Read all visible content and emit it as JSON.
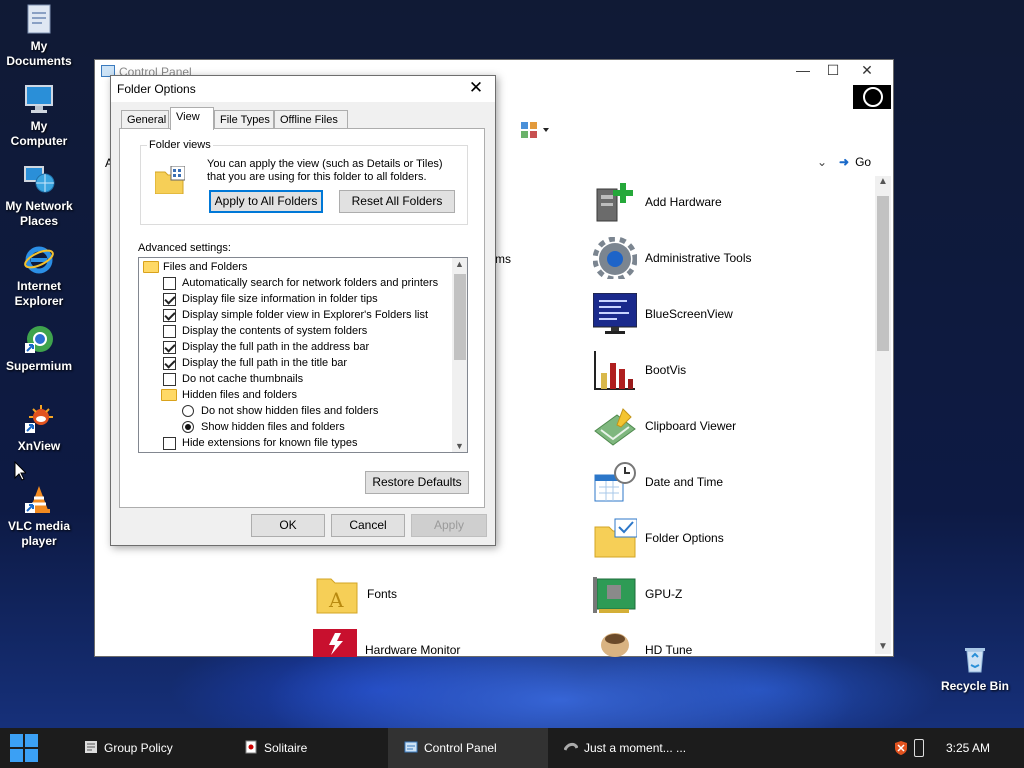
{
  "desktop": {
    "icons": [
      {
        "label": "My\nDocuments",
        "icon": "documents-icon"
      },
      {
        "label": "My\nComputer",
        "icon": "computer-icon"
      },
      {
        "label": "My Network\nPlaces",
        "icon": "network-icon"
      },
      {
        "label": "Internet\nExplorer",
        "icon": "internet-explorer-icon"
      },
      {
        "label": "Supermium",
        "icon": "supermium-icon"
      },
      {
        "label": "XnView",
        "icon": "xnview-icon"
      },
      {
        "label": "VLC media\nplayer",
        "icon": "vlc-icon"
      },
      {
        "label": "Recycle Bin",
        "icon": "recycle-bin-icon"
      }
    ]
  },
  "control_panel": {
    "title": "Control Panel",
    "address_letter": "A",
    "go_label": "Go",
    "partial_item": "ms",
    "items": [
      {
        "label": "Add Hardware",
        "icon": "add-hardware-icon"
      },
      {
        "label": "Administrative Tools",
        "icon": "gear-icon"
      },
      {
        "label": "BlueScreenView",
        "icon": "monitor-icon"
      },
      {
        "label": "BootVis",
        "icon": "bar-chart-icon"
      },
      {
        "label": "Clipboard Viewer",
        "icon": "clipboard-icon"
      },
      {
        "label": "Date and Time",
        "icon": "clock-calendar-icon"
      },
      {
        "label": "Folder Options",
        "icon": "folder-options-icon"
      },
      {
        "label": "Fonts",
        "icon": "fonts-folder-icon"
      },
      {
        "label": "GPU-Z",
        "icon": "gpu-card-icon"
      },
      {
        "label": "Hardware Monitor",
        "icon": "hardware-monitor-icon"
      },
      {
        "label": "HD Tune",
        "icon": "hd-tune-icon"
      }
    ]
  },
  "dialog": {
    "title": "Folder Options",
    "tabs": [
      "General",
      "View",
      "File Types",
      "Offline Files"
    ],
    "active_tab": "View",
    "folder_views": {
      "legend": "Folder views",
      "description": "You can apply the view (such as Details or Tiles) that you are using for this folder to all folders.",
      "apply_button": "Apply to All Folders",
      "reset_button": "Reset All Folders"
    },
    "advanced_label": "Advanced settings:",
    "settings": [
      {
        "kind": "folder",
        "label": "Files and Folders"
      },
      {
        "kind": "checkbox",
        "label": "Automatically search for network folders and printers",
        "checked": false
      },
      {
        "kind": "checkbox",
        "label": "Display file size information in folder tips",
        "checked": true
      },
      {
        "kind": "checkbox",
        "label": "Display simple folder view in Explorer's Folders list",
        "checked": true
      },
      {
        "kind": "checkbox",
        "label": "Display the contents of system folders",
        "checked": false
      },
      {
        "kind": "checkbox",
        "label": "Display the full path in the address bar",
        "checked": true
      },
      {
        "kind": "checkbox",
        "label": "Display the full path in the title bar",
        "checked": true
      },
      {
        "kind": "checkbox",
        "label": "Do not cache thumbnails",
        "checked": false
      },
      {
        "kind": "folder",
        "label": "Hidden files and folders"
      },
      {
        "kind": "radio",
        "label": "Do not show hidden files and folders",
        "checked": false
      },
      {
        "kind": "radio",
        "label": "Show hidden files and folders",
        "checked": true
      },
      {
        "kind": "checkbox",
        "label": "Hide extensions for known file types",
        "checked": false
      }
    ],
    "restore_button": "Restore Defaults",
    "ok_button": "OK",
    "cancel_button": "Cancel",
    "apply_button": "Apply"
  },
  "taskbar": {
    "items": [
      {
        "label": "Group Policy",
        "icon": "group-policy-icon"
      },
      {
        "label": "Solitaire",
        "icon": "solitaire-icon"
      },
      {
        "label": "Control Panel",
        "icon": "control-panel-icon"
      },
      {
        "label": "Just a moment... ...",
        "icon": "browser-icon"
      }
    ],
    "active_item": "Control Panel",
    "clock": "3:25 AM"
  },
  "colors": {
    "accent": "#0078d7",
    "taskbar": "#1c1c1c",
    "start": "#3ba0f4"
  }
}
